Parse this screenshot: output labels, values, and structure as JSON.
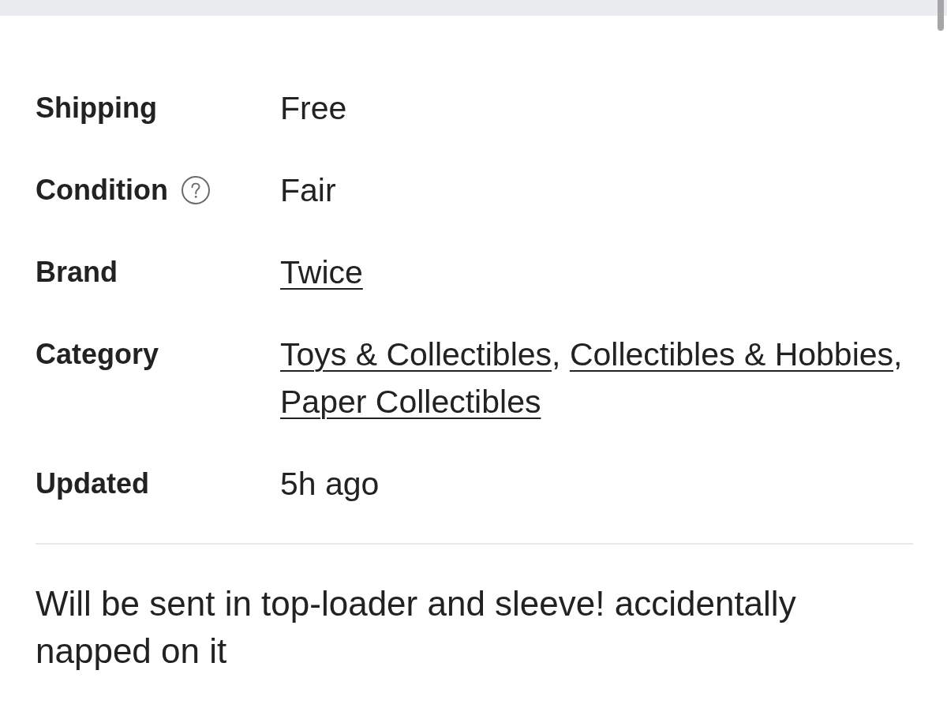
{
  "details": [
    {
      "label": "Shipping",
      "kind": "text",
      "value": "Free"
    },
    {
      "label": "Condition",
      "kind": "text",
      "value": "Fair",
      "help_icon": true
    },
    {
      "label": "Brand",
      "kind": "link",
      "value": "Twice"
    },
    {
      "label": "Category",
      "kind": "links",
      "links": [
        "Toys & Collectibles",
        "Collectibles & Hobbies",
        "Paper Collectibles"
      ],
      "separator": ","
    },
    {
      "label": "Updated",
      "kind": "text",
      "value": "5h ago"
    }
  ],
  "description": "Will be sent in top-loader and sleeve! accidentally napped on it"
}
